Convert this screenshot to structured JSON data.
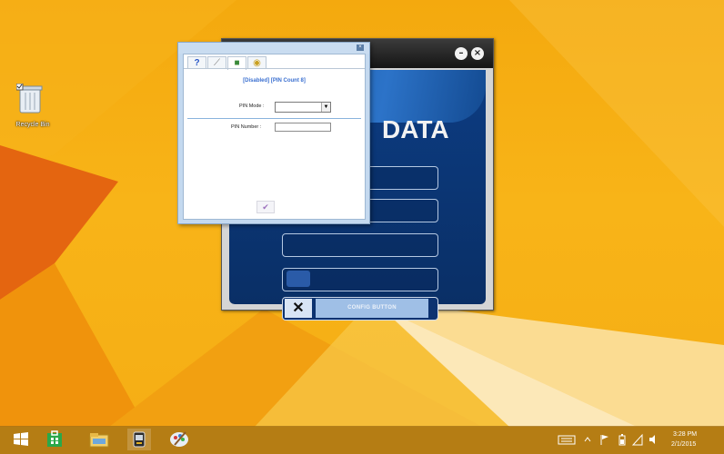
{
  "desktop": {
    "icons": [
      {
        "label": "Recycle Bin"
      }
    ]
  },
  "main_app": {
    "brand": "DATA",
    "minimize_symbol": "–",
    "close_symbol": "×",
    "config_button_label": "CONFIG BUTTON"
  },
  "pin_dialog": {
    "close_symbol": "×",
    "tabs": [
      {
        "icon": "help-icon",
        "glyph": "?"
      },
      {
        "icon": "wrench-icon",
        "glyph": "⟋"
      },
      {
        "icon": "chip-icon",
        "glyph": "■"
      },
      {
        "icon": "key-icon",
        "glyph": "◉"
      }
    ],
    "status": "[Disabled] [PIN Count 8]",
    "pin_mode_label": "PIN Mode :",
    "pin_mode_value": "",
    "pin_number_label": "PIN Number :",
    "pin_number_value": "",
    "ok_glyph": "✔"
  },
  "taskbar": {
    "items": [
      {
        "icon": "windows-start-icon"
      },
      {
        "icon": "store-icon"
      },
      {
        "icon": "file-explorer-icon"
      },
      {
        "icon": "usb-device-icon"
      },
      {
        "icon": "paint-icon"
      }
    ],
    "tray": {
      "time": "3:28 PM",
      "date": "2/1/2015"
    }
  },
  "colors": {
    "desktop_orange": "#f8b418",
    "app_blue": "#0c3c82",
    "dialog_frame": "#c4d9ef",
    "status_blue": "#3a6fd0"
  }
}
